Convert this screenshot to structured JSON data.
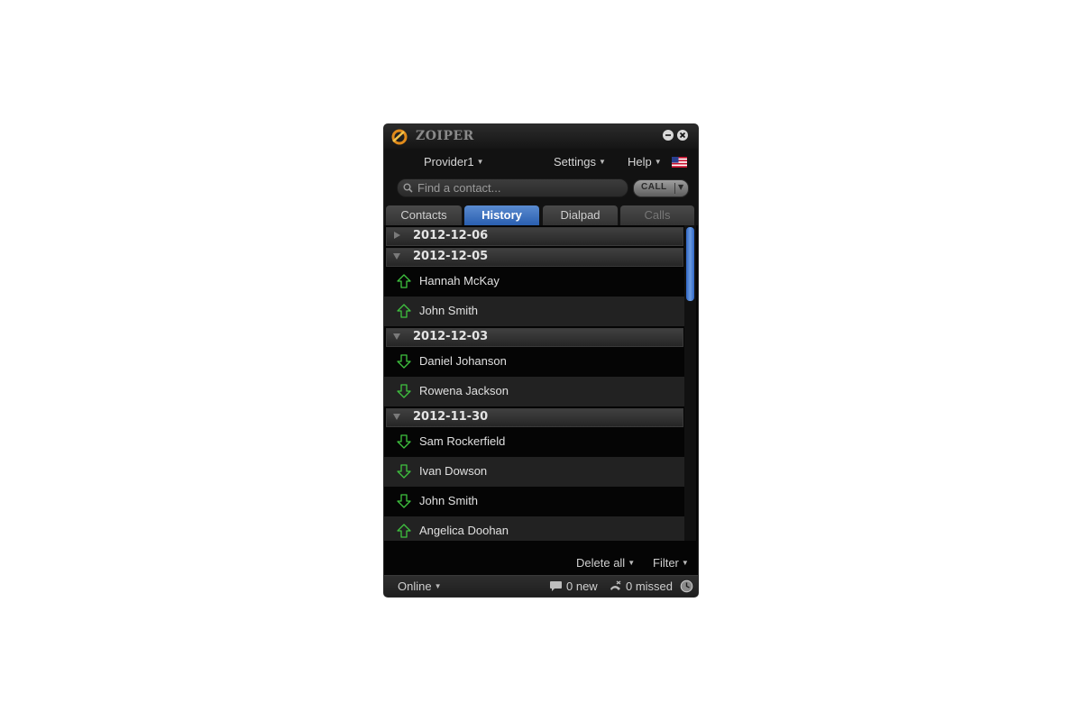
{
  "app": {
    "title": "ZOIPER"
  },
  "menubar": {
    "provider": "Provider1",
    "settings": "Settings",
    "help": "Help"
  },
  "search": {
    "placeholder": "Find a contact...",
    "value": "",
    "call_label": "CALL"
  },
  "tabs": [
    {
      "label": "Contacts"
    },
    {
      "label": "History"
    },
    {
      "label": "Dialpad"
    },
    {
      "label": "Calls"
    }
  ],
  "history": {
    "groups": [
      {
        "date": "2012-12-06",
        "expanded": false,
        "entries": []
      },
      {
        "date": "2012-12-05",
        "expanded": true,
        "entries": [
          {
            "name": "Hannah McKay",
            "direction": "outgoing"
          },
          {
            "name": "John Smith",
            "direction": "outgoing"
          }
        ]
      },
      {
        "date": "2012-12-03",
        "expanded": true,
        "entries": [
          {
            "name": "Daniel Johanson",
            "direction": "incoming"
          },
          {
            "name": "Rowena Jackson",
            "direction": "incoming"
          }
        ]
      },
      {
        "date": "2012-11-30",
        "expanded": true,
        "entries": [
          {
            "name": "Sam Rockerfield",
            "direction": "incoming"
          },
          {
            "name": "Ivan Dowson",
            "direction": "incoming"
          },
          {
            "name": "John Smith",
            "direction": "incoming"
          },
          {
            "name": "Angelica Doohan",
            "direction": "outgoing"
          }
        ]
      }
    ]
  },
  "footer": {
    "delete_all": "Delete all",
    "filter": "Filter"
  },
  "status": {
    "presence": "Online",
    "new_messages": "0 new",
    "missed_calls": "0 missed"
  },
  "colors": {
    "accent": "#2f66c4",
    "call_icon": "#3fc23f"
  }
}
